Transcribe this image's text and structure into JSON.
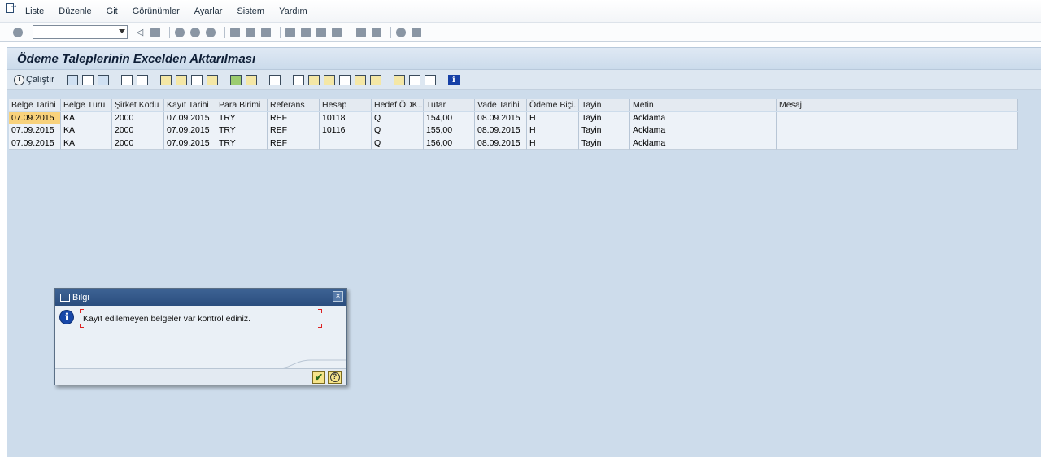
{
  "menubar": {
    "items": [
      "Liste",
      "Düzenle",
      "Git",
      "Görünümler",
      "Ayarlar",
      "Sistem",
      "Yardım"
    ]
  },
  "title": "Ödeme Taleplerinin Excelden Aktarılması",
  "toolbar": {
    "run_label": "Çalıştır"
  },
  "grid": {
    "columns": [
      "Belge Tarihi",
      "Belge Türü",
      "Şirket Kodu",
      "Kayıt Tarihi",
      "Para Birimi",
      "Referans",
      "Hesap",
      "Hedef ÖDK...",
      "Tutar",
      "Vade Tarihi",
      "Ödeme Biçi...",
      "Tayin",
      "Metin",
      "Mesaj"
    ],
    "rows": [
      [
        "07.09.2015",
        "KA",
        "2000",
        "07.09.2015",
        "TRY",
        "REF",
        "10118",
        "Q",
        "154,00",
        "08.09.2015",
        "H",
        "Tayin",
        "Acklama",
        ""
      ],
      [
        "07.09.2015",
        "KA",
        "2000",
        "07.09.2015",
        "TRY",
        "REF",
        "10116",
        "Q",
        "155,00",
        "08.09.2015",
        "H",
        "Tayin",
        "Acklama",
        ""
      ],
      [
        "07.09.2015",
        "KA",
        "2000",
        "07.09.2015",
        "TRY",
        "REF",
        "",
        "Q",
        "156,00",
        "08.09.2015",
        "H",
        "Tayin",
        "Acklama",
        ""
      ]
    ]
  },
  "dialog": {
    "title": "Bilgi",
    "message": "Kayıt edilemeyen belgeler var kontrol ediniz."
  }
}
